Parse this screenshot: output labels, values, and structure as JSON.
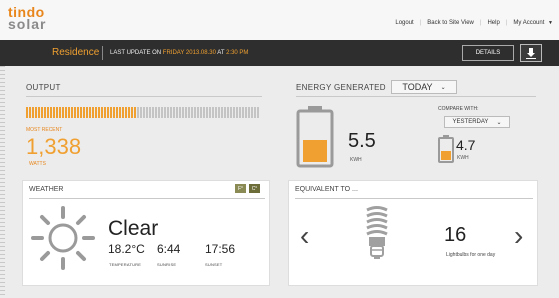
{
  "brand": {
    "line1": "tindo",
    "line2": "solar",
    "accent": "#f0a030"
  },
  "topnav": {
    "logout": "Logout",
    "back": "Back to Site View",
    "help": "Help",
    "account": "My Account"
  },
  "bar": {
    "site": "Residence",
    "update_label": "LAST UPDATE ON ",
    "update_value": "FRIDAY 2013.08.30",
    "update_at": " AT ",
    "update_time": "2:30 PM",
    "details": "DETAILS"
  },
  "output": {
    "title": "OUTPUT",
    "recent_label": "MOST RECENT",
    "value": "1,338",
    "unit": "WATTS",
    "level": 0.48
  },
  "energy": {
    "title": "ENERGY GENERATED",
    "period": "TODAY",
    "value": "5.5",
    "unit": "KWH",
    "battery_level": 0.45,
    "compare_label": "COMPARE WITH:",
    "compare_period": "YESTERDAY",
    "compare_value": "4.7",
    "compare_unit": "KWH",
    "compare_level": 0.4
  },
  "weather": {
    "title": "WEATHER",
    "unit_f": "F°",
    "unit_c": "C°",
    "condition": "Clear",
    "temp": "18.2°C",
    "temp_label": "TEMPERATURE",
    "sunrise": "6:44",
    "sunrise_label": "SUNRISE",
    "sunset": "17:56",
    "sunset_label": "SUNSET",
    "icon": "sun-icon"
  },
  "equivalent": {
    "title": "EQUIVALENT TO ...",
    "value": "16",
    "label": "Lightbulbs for one day",
    "icon": "lightbulb-icon"
  }
}
